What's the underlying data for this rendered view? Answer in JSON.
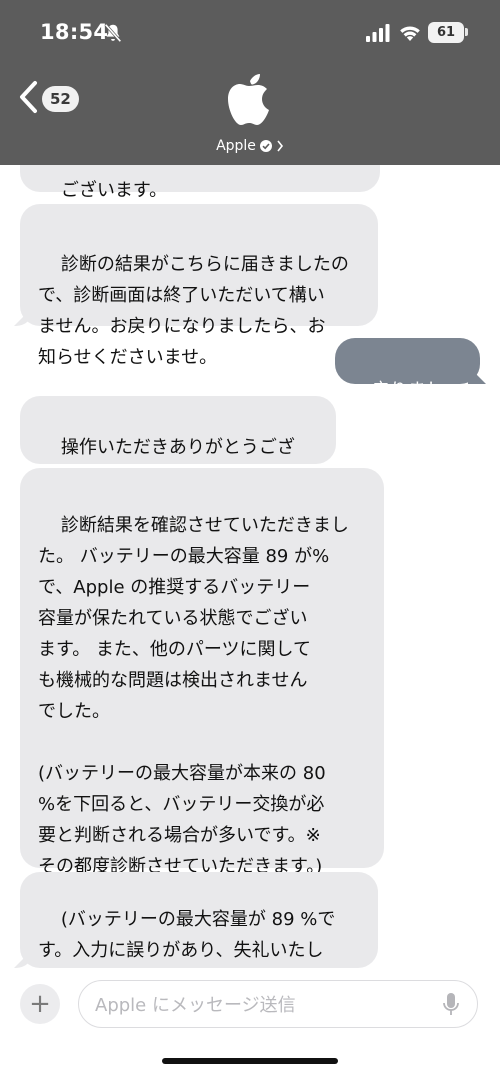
{
  "status_bar": {
    "time": "18:54",
    "battery": "61",
    "icons": [
      "bell-slash-icon",
      "cellular-signal-icon",
      "wifi-icon",
      "battery-icon"
    ]
  },
  "header": {
    "back_count": "52",
    "contact_name": "Apple",
    "logo": "apple-logo",
    "background_color": "#5c5c5c"
  },
  "messages": [
    {
      "direction": "incoming",
      "text": "ございます。"
    },
    {
      "direction": "incoming",
      "text": "診断の結果がこちらに届きましたの\nで、診断画面は終了いただいて構い\nません。お戻りになりましたら、お\n知らせくださいませ。"
    },
    {
      "direction": "outgoing",
      "text": "戻りました。"
    },
    {
      "direction": "incoming",
      "text": "操作いただきありがとうござ\nいます。"
    },
    {
      "direction": "incoming",
      "text": "診断結果を確認させていただきまし\nた。 バッテリーの最大容量 89 が%\nで、Apple の推奨するバッテリー\n容量が保たれている状態でござい\nます。 また、他のパーツに関して\nも機械的な問題は検出されません\nでした。\n\n(バッテリーの最大容量が本来の 80\n%を下回ると、バッテリー交換が必\n要と判断される場合が多いです。※\nその都度診断させていただきます。)\n\n上記についてご不明点やご不安点は\nございませんか？"
    },
    {
      "direction": "incoming",
      "text": "(バッテリーの最大容量が 89 %で\nす。入力に誤りがあり、失礼いたし\nました。)"
    }
  ],
  "colors": {
    "incoming_bubble": "#e9e9eb",
    "outgoing_bubble": "#7c8591"
  },
  "composer": {
    "placeholder": "Apple にメッセージ送信",
    "value": ""
  }
}
